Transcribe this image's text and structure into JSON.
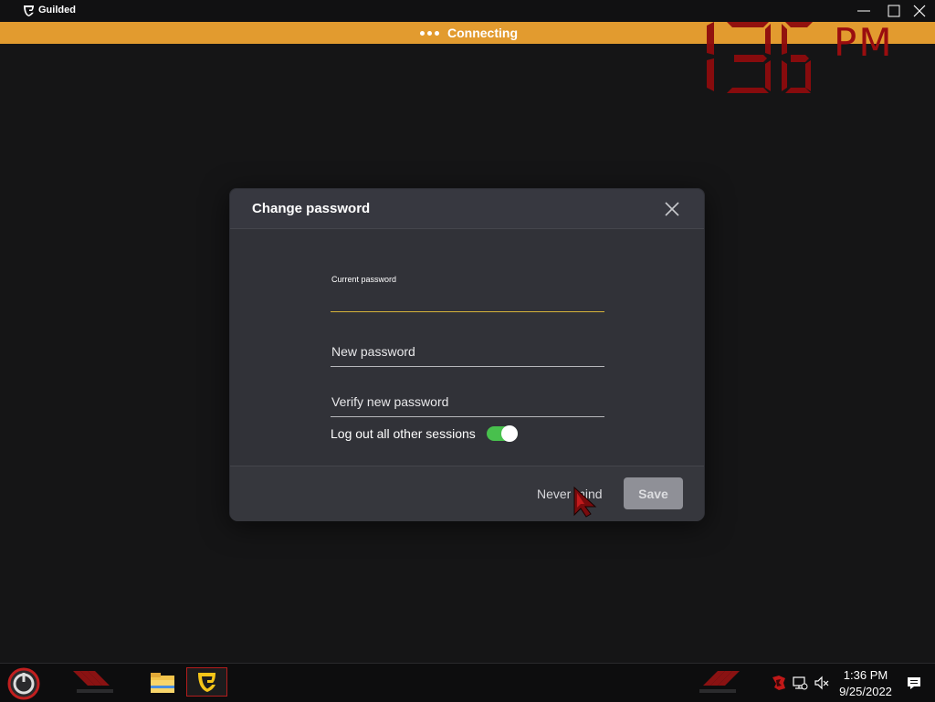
{
  "window": {
    "app_title": "Guilded",
    "banner_text": "Connecting",
    "overlay_clock": {
      "time": "1:36",
      "ampm": "PM"
    }
  },
  "dialog": {
    "title": "Change password",
    "fields": {
      "current_password": {
        "label": "Current password",
        "value": ""
      },
      "new_password": {
        "placeholder": "New password",
        "value": ""
      },
      "verify_password": {
        "placeholder": "Verify new password",
        "value": ""
      }
    },
    "toggle": {
      "label": "Log out all other sessions",
      "on": true
    },
    "buttons": {
      "cancel": "Never mind",
      "save": "Save"
    }
  },
  "taskbar": {
    "time": "1:36 PM",
    "date": "9/25/2022"
  },
  "colors": {
    "banner": "#e29b2f",
    "toggle_on": "#48c04d",
    "active_underline": "#d6b43a",
    "accent_red": "#b31d1d"
  },
  "icons": [
    "guilded-logo-icon",
    "minimize-icon",
    "maximize-icon",
    "close-icon",
    "mouse-cursor-icon",
    "start-icon",
    "file-explorer-icon",
    "guilded-taskbar-icon",
    "msi-dragon-icon",
    "network-icon",
    "volume-muted-icon",
    "notification-icon"
  ]
}
